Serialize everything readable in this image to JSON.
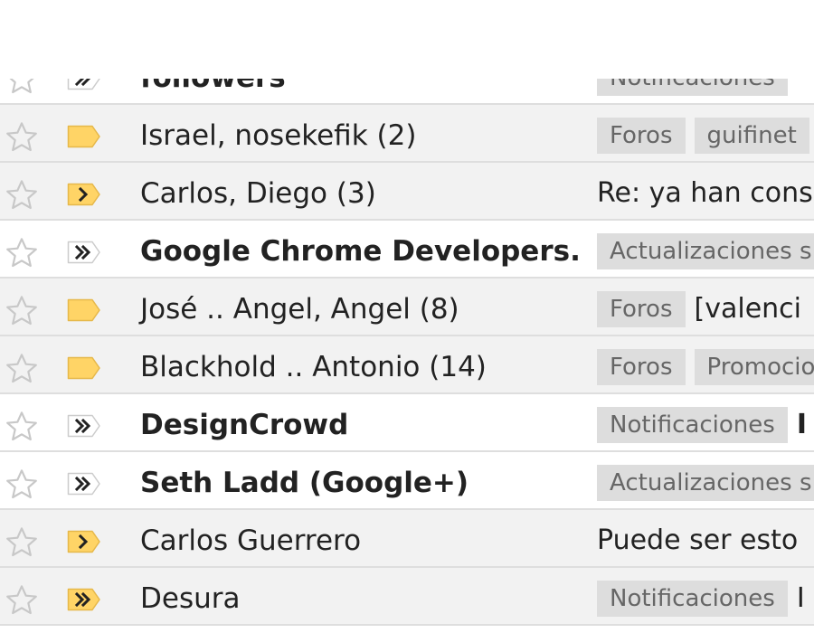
{
  "colors": {
    "label_bg": "#dddddd",
    "label_text": "#666666",
    "marker_yellow": "#ffd466",
    "row_read": "#f2f2f2",
    "row_unread": "#ffffff"
  },
  "icons": {
    "star": "star-outline",
    "importance_plain": "label-tag",
    "importance_single": "single-chevron",
    "importance_double": "double-chevron"
  },
  "rows": [
    {
      "sender": "followers",
      "labels": [
        "Notificaciones"
      ],
      "subject": "",
      "marker": "double-chevron-gray",
      "unread": true,
      "partial": true
    },
    {
      "sender": "Israel, nosekefik (2)",
      "labels": [
        "Foros",
        "guifinet"
      ],
      "subject": "",
      "marker": "plain-yellow",
      "unread": false
    },
    {
      "sender": "Carlos, Diego (3)",
      "labels": [],
      "subject": "Re: ya han cons",
      "marker": "single-chevron-yellow",
      "unread": false
    },
    {
      "sender": "Google Chrome Developers.",
      "labels": [
        "Actualizaciones s"
      ],
      "subject": "",
      "marker": "double-chevron-gray",
      "unread": true
    },
    {
      "sender": "José .. Angel, Angel (8)",
      "labels": [
        "Foros"
      ],
      "subject": "[valenci",
      "marker": "plain-yellow",
      "unread": false
    },
    {
      "sender": "Blackhold .. Antonio (14)",
      "labels": [
        "Foros",
        "Promocio"
      ],
      "subject": "",
      "marker": "plain-yellow",
      "unread": false
    },
    {
      "sender": "DesignCrowd",
      "labels": [
        "Notificaciones"
      ],
      "subject": "I",
      "marker": "double-chevron-gray",
      "unread": true
    },
    {
      "sender": "Seth Ladd (Google+)",
      "labels": [
        "Actualizaciones s"
      ],
      "subject": "",
      "marker": "double-chevron-gray",
      "unread": true
    },
    {
      "sender": "Carlos Guerrero",
      "labels": [],
      "subject": "Puede ser esto",
      "marker": "single-chevron-yellow",
      "unread": false
    },
    {
      "sender": "Desura",
      "labels": [
        "Notificaciones"
      ],
      "subject": "I",
      "marker": "double-chevron-yellow",
      "unread": false
    }
  ]
}
